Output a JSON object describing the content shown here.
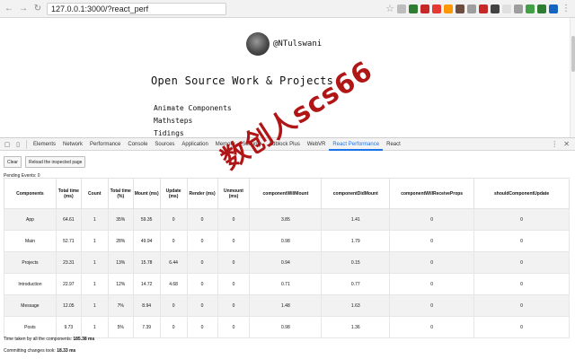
{
  "browser": {
    "url": "127.0.0.1:3000/?react_perf"
  },
  "page": {
    "handle": "@NTulswani",
    "title": "Open Source Work & Projects",
    "projects": [
      "Animate Components",
      "Mathsteps",
      "Tidings"
    ]
  },
  "watermark": "数创人scs66",
  "devtools": {
    "tabs": [
      "Elements",
      "Network",
      "Performance",
      "Console",
      "Sources",
      "Application",
      "Memory",
      "Security",
      "Adblock Plus",
      "WebVR",
      "React Performance",
      "React"
    ],
    "active_tab": "React Performance",
    "clear_label": "Clear",
    "reload_label": "Reload the inspected page",
    "pending_events": "Pending Events: 0",
    "table": {
      "headers": [
        "Components",
        "Total time (ms)",
        "Count",
        "Total time (%)",
        "Mount (ms)",
        "Update (ms)",
        "Render (ms)",
        "Unmount (ms)",
        "componentWillMount",
        "componentDidMount",
        "componentWillReceiveProps",
        "shouldComponentUpdate"
      ],
      "rows": [
        [
          "App",
          "64.61",
          "1",
          "35%",
          "59.35",
          "0",
          "0",
          "0",
          "3.85",
          "1.41",
          "0",
          "0"
        ],
        [
          "Main",
          "52.71",
          "1",
          "28%",
          "49.94",
          "0",
          "0",
          "0",
          "0.98",
          "1.79",
          "0",
          "0"
        ],
        [
          "Projects",
          "23.31",
          "1",
          "13%",
          "15.78",
          "6.44",
          "0",
          "0",
          "0.94",
          "0.15",
          "0",
          "0"
        ],
        [
          "Introduction",
          "22.97",
          "1",
          "12%",
          "14.72",
          "4.68",
          "0",
          "0",
          "0.71",
          "0.77",
          "0",
          "0"
        ],
        [
          "Message",
          "12.05",
          "1",
          "7%",
          "8.94",
          "0",
          "0",
          "0",
          "1.48",
          "1.63",
          "0",
          "0"
        ],
        [
          "Posts",
          "9.73",
          "1",
          "5%",
          "7.39",
          "0",
          "0",
          "0",
          "0.98",
          "1.36",
          "0",
          "0"
        ]
      ]
    },
    "time_taken_label": "Time taken by all the components:",
    "time_taken_value": "185.38 ms",
    "committing_label": "Committing changes took:",
    "committing_value": "18.33 ms"
  }
}
